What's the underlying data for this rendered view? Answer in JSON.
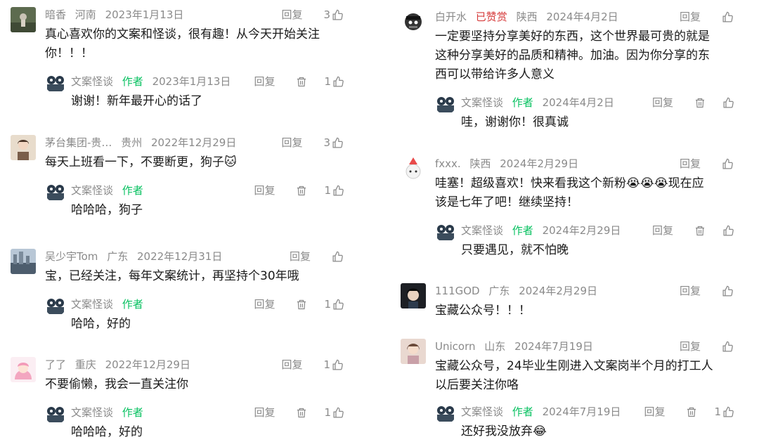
{
  "left_column": [
    {
      "name": "暗香",
      "location": "河南",
      "date": "2023年1月13日",
      "reply_label": "回复",
      "likes": "3",
      "text_lines": [
        "真心喜欢你的文案和怪谈，很有趣！从今天开始关注",
        "你！！！"
      ],
      "reply": {
        "name": "文案怪谈",
        "tag": "作者",
        "date": "2023年1月13日",
        "reply_label": "回复",
        "likes": "1",
        "text": "谢谢！新年最开心的话了"
      }
    },
    {
      "name": "茅台集团-贵…",
      "location": "贵州",
      "date": "2022年12月29日",
      "reply_label": "回复",
      "likes": "3",
      "text_lines": [
        "每天上班看一下，不要断更，狗子🐱"
      ],
      "reply": {
        "name": "文案怪谈",
        "tag": "作者",
        "date": "",
        "reply_label": "回复",
        "likes": "1",
        "text": "哈哈哈，狗子"
      }
    },
    {
      "name": "吴少宇Tom",
      "location": "广东",
      "date": "2022年12月31日",
      "reply_label": "回复",
      "likes": "",
      "text_lines": [
        "宝，已经关注，每年文案统计，再坚持个30年哦"
      ],
      "reply": {
        "name": "文案怪谈",
        "tag": "作者",
        "date": "",
        "reply_label": "回复",
        "likes": "1",
        "text": "哈哈，好的"
      }
    },
    {
      "name": "了了",
      "location": "重庆",
      "date": "2022年12月29日",
      "reply_label": "回复",
      "likes": "1",
      "text_lines": [
        "不要偷懒，我会一直关注你"
      ],
      "reply": {
        "name": "文案怪谈",
        "tag": "作者",
        "date": "",
        "reply_label": "回复",
        "likes": "1",
        "text": "哈哈哈，好的"
      }
    }
  ],
  "right_column": [
    {
      "name": "白开水",
      "badge": "已赞赏",
      "location": "陕西",
      "date": "2024年4月2日",
      "reply_label": "回复",
      "likes": "",
      "text_lines": [
        "一定要坚持分享美好的东西，这个世界最可贵的就是",
        "这种分享美好的品质和精神。加油。因为你分享的东",
        "西可以带给许多人意义"
      ],
      "reply": {
        "name": "文案怪谈",
        "tag": "作者",
        "date": "2024年4月2日",
        "reply_label": "回复",
        "likes": "",
        "text": "哇，谢谢你！很真诚"
      }
    },
    {
      "name": "fxxx.",
      "location": "陕西",
      "date": "2024年2月29日",
      "reply_label": "回复",
      "likes": "",
      "text_lines": [
        "哇塞！超级喜欢！快来看我这个新粉😭😭😭现在应",
        "该是七年了吧！继续坚持！"
      ],
      "reply": {
        "name": "文案怪谈",
        "tag": "作者",
        "date": "2024年2月29日",
        "reply_label": "回复",
        "likes": "",
        "text": "只要遇见，就不怕晚"
      }
    },
    {
      "name": "111GOD",
      "location": "广东",
      "date": "2024年2月29日",
      "reply_label": "回复",
      "likes": "",
      "text_lines": [
        "宝藏公众号！！！"
      ]
    },
    {
      "name": "Unicorn",
      "location": "山东",
      "date": "2024年7月19日",
      "reply_label": "回复",
      "likes": "",
      "text_lines": [
        "宝藏公众号，24毕业生刚进入文案岗半个月的打工人",
        "以后要关注你咯"
      ],
      "reply": {
        "name": "文案怪谈",
        "tag": "作者",
        "date": "2024年7月19日",
        "reply_label": "回复",
        "likes": "1",
        "text": "还好我没放弃😂"
      }
    }
  ],
  "colors": {
    "author_tag": "#07c160",
    "badge": "#d63b3b",
    "meta": "#8a8a8a",
    "text": "#1a1a1a"
  },
  "icons": [
    "thumb-up-icon",
    "trash-icon",
    "avatar"
  ]
}
